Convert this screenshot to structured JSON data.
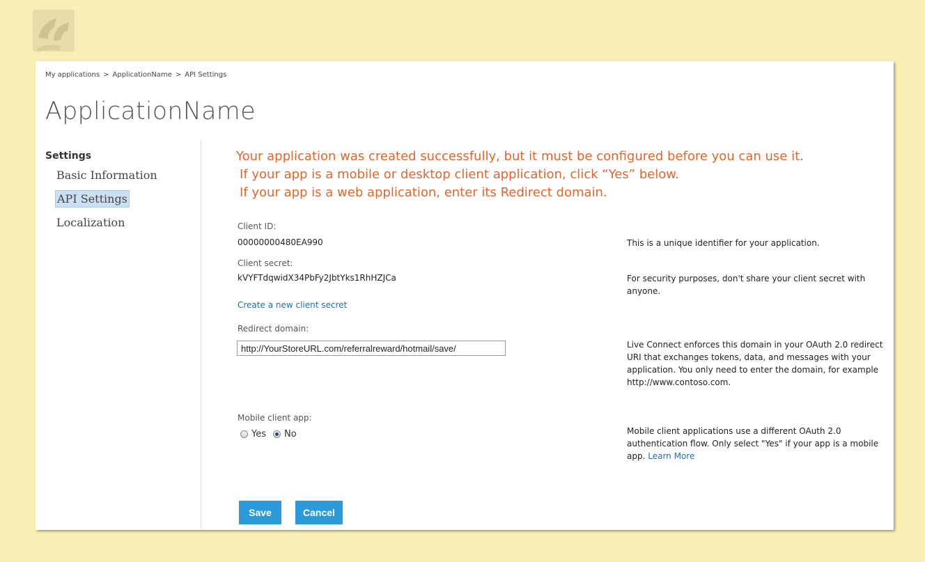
{
  "logo": {
    "alt": "logo"
  },
  "breadcrumb": {
    "items": [
      "My applications",
      "ApplicationName",
      "API Settings"
    ],
    "separator": ">"
  },
  "title": "ApplicationName",
  "sidebar": {
    "heading": "Settings",
    "items": [
      {
        "label": "Basic Information",
        "active": false
      },
      {
        "label": "API Settings",
        "active": true
      },
      {
        "label": "Localization",
        "active": false
      }
    ]
  },
  "message": {
    "lines": [
      "Your application was created successfully, but it must be configured before you can use it.",
      "If your app is a mobile or desktop client application, click “Yes” below.",
      "If your app is a web application, enter its Redirect domain."
    ]
  },
  "fields": {
    "client_id": {
      "label": "Client ID:",
      "value": "00000000480EA990",
      "help": "This is a unique identifier for your application."
    },
    "client_secret": {
      "label": "Client secret:",
      "value": "kVYFTdqwidX34PbFy2JbtYks1RhHZJCa",
      "help": "For security purposes, don't share your client secret with anyone.",
      "link": "Create a new client secret"
    },
    "redirect_domain": {
      "label": "Redirect domain:",
      "value": "http://YourStoreURL.com/referralreward/hotmail/save/",
      "help": "Live Connect enforces this domain in your OAuth 2.0 redirect URI that exchanges tokens, data, and messages with your application. You only need to enter the domain, for example http://www.contoso.com."
    },
    "mobile_client": {
      "label": "Mobile client app:",
      "options": [
        "Yes",
        "No"
      ],
      "selected": "No",
      "help": "Mobile client applications use a different OAuth 2.0 authentication flow. Only select \"Yes\" if your app is a mobile app.",
      "help_link": "Learn More"
    }
  },
  "buttons": {
    "save": "Save",
    "cancel": "Cancel"
  },
  "colors": {
    "background": "#f9eeb3",
    "accent": "#2b9ad8",
    "message": "#e0662c",
    "link": "#1f6fb2"
  }
}
